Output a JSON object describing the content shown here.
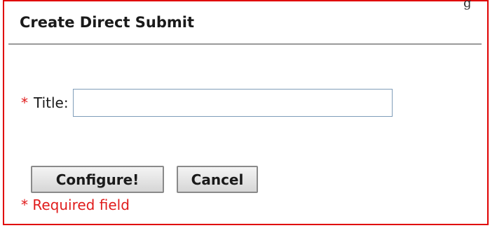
{
  "dialog": {
    "title": "Create Direct Submit",
    "top_edge_glyph": "g"
  },
  "form": {
    "required_marker": "*",
    "title_label": "Title:",
    "title_value": "",
    "title_placeholder": ""
  },
  "buttons": {
    "configure_label": "Configure!",
    "cancel_label": "Cancel"
  },
  "footer": {
    "required_marker": "*",
    "required_text": "Required field"
  },
  "colors": {
    "frame_border": "#e00000",
    "required_red": "#e01b1b",
    "input_border": "#7f9db9",
    "rule_gray": "#9a9a9a"
  }
}
